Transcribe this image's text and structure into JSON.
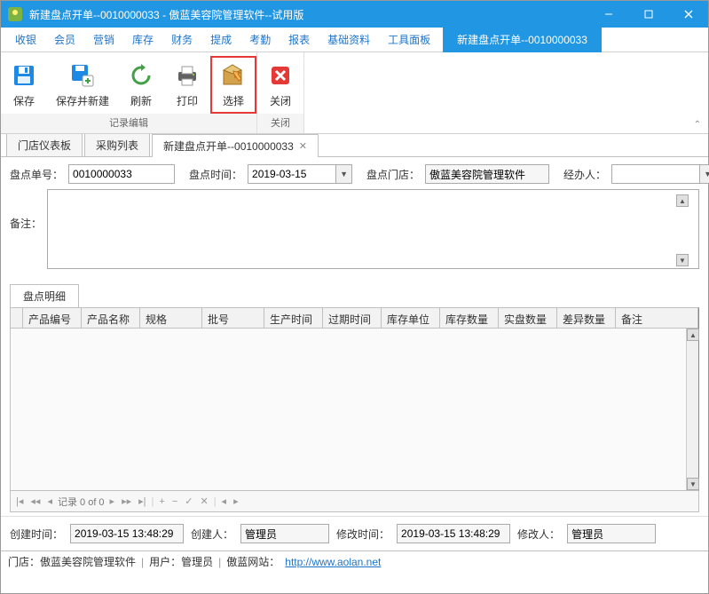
{
  "window": {
    "title": "新建盘点开单--0010000033 - 傲蓝美容院管理软件--试用版"
  },
  "menus": [
    "收银",
    "会员",
    "营销",
    "库存",
    "财务",
    "提成",
    "考勤",
    "报表",
    "基础资料",
    "工具面板"
  ],
  "active_menu_tab": "新建盘点开单--0010000033",
  "ribbon": {
    "group1_label": "记录编辑",
    "group2_label": "关闭",
    "save": "保存",
    "save_new": "保存并新建",
    "refresh": "刷新",
    "print": "打印",
    "select": "选择",
    "close": "关闭"
  },
  "doc_tabs": {
    "tab1": "门店仪表板",
    "tab2": "采购列表",
    "tab3": "新建盘点开单--0010000033"
  },
  "form": {
    "order_no_label": "盘点单号：",
    "order_no": "0010000033",
    "time_label": "盘点时间：",
    "time": "2019-03-15",
    "store_label": "盘点门店：",
    "store": "傲蓝美容院管理软件",
    "operator_label": "经办人：",
    "operator": "",
    "remarks_label": "备注：",
    "remarks": ""
  },
  "detail_tab": "盘点明细",
  "grid_cols": [
    "产品编号",
    "产品名称",
    "规格",
    "批号",
    "生产时间",
    "过期时间",
    "库存单位",
    "库存数量",
    "实盘数量",
    "差异数量",
    "备注"
  ],
  "paginator": {
    "record": "记录 0 of 0"
  },
  "footer": {
    "create_time_label": "创建时间：",
    "create_time": "2019-03-15 13:48:29",
    "creator_label": "创建人：",
    "creator": "管理员",
    "modify_time_label": "修改时间：",
    "modify_time": "2019-03-15 13:48:29",
    "modifier_label": "修改人：",
    "modifier": "管理员"
  },
  "status": {
    "store": "门店：傲蓝美容院管理软件",
    "user": "用户：管理员",
    "site_label": "傲蓝网站：",
    "site_url": "http://www.aolan.net"
  }
}
